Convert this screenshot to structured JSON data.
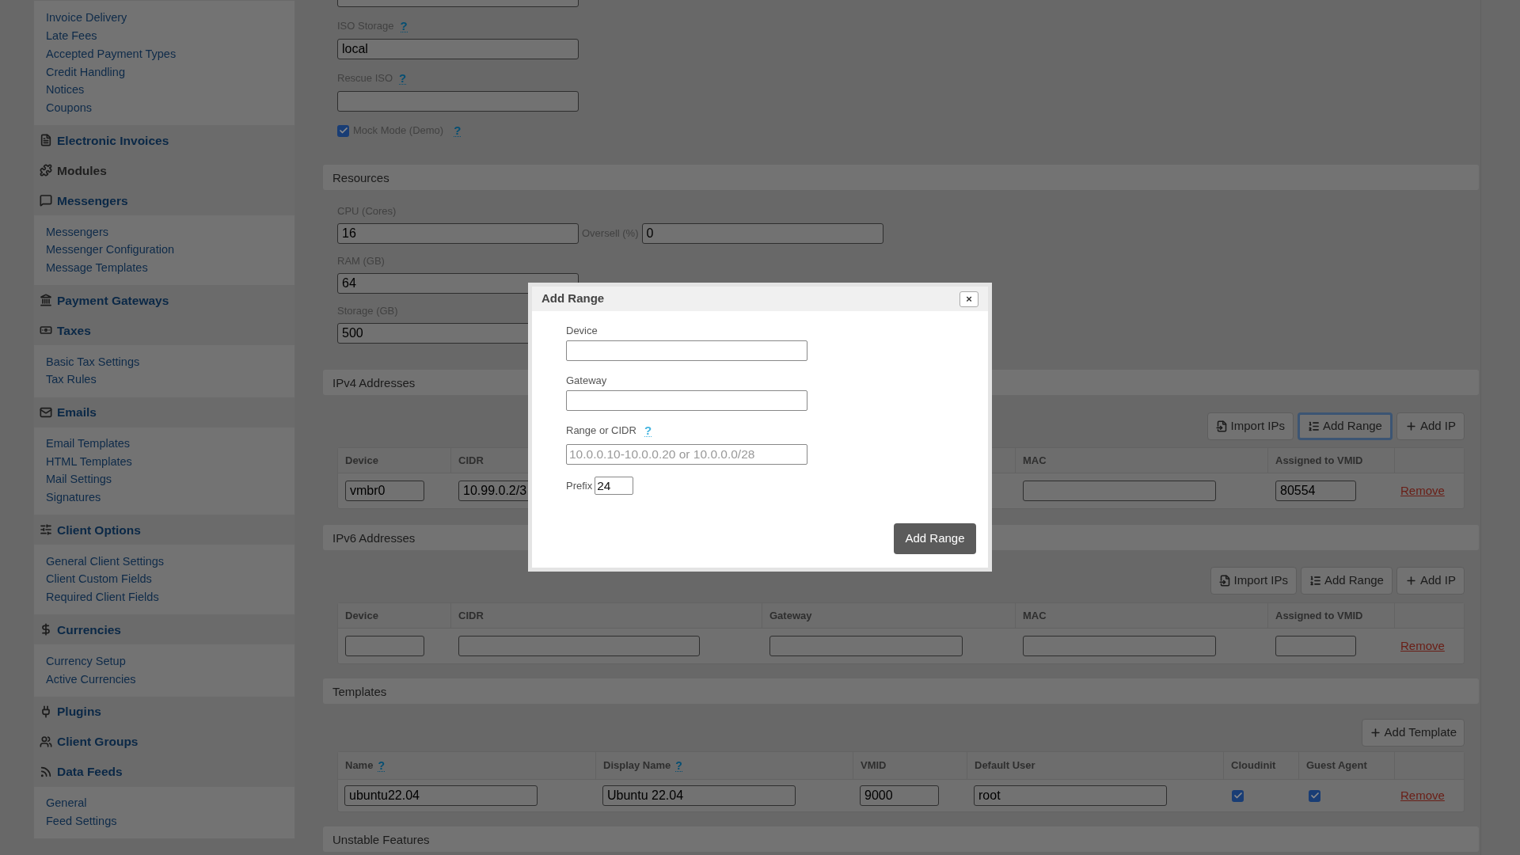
{
  "sidebar": {
    "top_items": [
      "Invoice Delivery",
      "Late Fees",
      "Accepted Payment Types",
      "Credit Handling",
      "Notices",
      "Coupons"
    ],
    "sections": [
      {
        "title": "Electronic Invoices",
        "selected": false
      },
      {
        "title": "Modules",
        "selected": true
      },
      {
        "title": "Messengers",
        "selected": false,
        "items": [
          "Messengers",
          "Messenger Configuration",
          "Message Templates"
        ]
      },
      {
        "title": "Payment Gateways",
        "selected": false
      },
      {
        "title": "Taxes",
        "selected": false,
        "items": [
          "Basic Tax Settings",
          "Tax Rules"
        ]
      },
      {
        "title": "Emails",
        "selected": false,
        "items": [
          "Email Templates",
          "HTML Templates",
          "Mail Settings",
          "Signatures"
        ]
      },
      {
        "title": "Client Options",
        "selected": false,
        "items": [
          "General Client Settings",
          "Client Custom Fields",
          "Required Client Fields"
        ]
      },
      {
        "title": "Currencies",
        "selected": false,
        "items": [
          "Currency Setup",
          "Active Currencies"
        ]
      },
      {
        "title": "Plugins",
        "selected": false
      },
      {
        "title": "Client Groups",
        "selected": false
      },
      {
        "title": "Data Feeds",
        "selected": false,
        "items": [
          "General",
          "Feed Settings"
        ]
      }
    ]
  },
  "general": {
    "iso_storage": {
      "label": "ISO Storage",
      "help": "?",
      "value": "local"
    },
    "rescue_iso": {
      "label": "Rescue ISO",
      "help": "?"
    },
    "mock_mode": {
      "label": "Mock Mode (Demo)",
      "help": "?",
      "checked": true
    }
  },
  "resources": {
    "title": "Resources",
    "rows": [
      {
        "label": "CPU (Cores)",
        "value": "16",
        "oversell_label": "Oversell (%)",
        "oversell_value": "0"
      },
      {
        "label": "RAM (GB)",
        "value": "64"
      },
      {
        "label": "Storage (GB)",
        "value": "500"
      }
    ]
  },
  "ipv4": {
    "title": "IPv4 Addresses",
    "buttons": [
      {
        "label": "Import IPs",
        "kind": "import",
        "focused": false
      },
      {
        "label": "Add Range",
        "kind": "range",
        "focused": true
      },
      {
        "label": "Add IP",
        "kind": "add",
        "focused": false
      }
    ],
    "columns": [
      {
        "kind": "device",
        "label": "Device"
      },
      {
        "kind": "cidr",
        "label": "CIDR"
      },
      {
        "kind": "mac",
        "label": "MAC"
      },
      {
        "kind": "vmid",
        "label": "Assigned to VMID"
      }
    ],
    "rows": [
      {
        "device": "vmbr0",
        "cidr": "10.99.0.2/3",
        "vmid": "80554",
        "action": "Remove"
      }
    ]
  },
  "ipv6": {
    "title": "IPv6 Addresses",
    "buttons": [
      {
        "label": "Import IPs",
        "kind": "import",
        "focused": false
      },
      {
        "label": "Add Range",
        "kind": "range",
        "focused": false
      },
      {
        "label": "Add IP",
        "kind": "add",
        "focused": false
      }
    ],
    "columns": [
      {
        "kind": "device",
        "label": "Device"
      },
      {
        "kind": "cidr",
        "label": "CIDR"
      },
      {
        "kind": "gateway",
        "label": "Gateway"
      },
      {
        "kind": "mac",
        "label": "MAC"
      },
      {
        "kind": "vmid",
        "label": "Assigned to VMID"
      }
    ],
    "rows": [
      {
        "action": "Remove"
      }
    ]
  },
  "templates": {
    "title": "Templates",
    "add_button": "Add Template",
    "columns": [
      {
        "label": "Name",
        "help": "?"
      },
      {
        "label": "Display Name",
        "help": "?"
      },
      {
        "label": "VMID"
      },
      {
        "label": "Default User"
      },
      {
        "label": "Cloudinit"
      },
      {
        "label": "Guest Agent"
      }
    ],
    "rows": [
      {
        "name": "ubuntu22.04",
        "display_name": "Ubuntu 22.04",
        "vmid": "9000",
        "default_user": "root",
        "cloudinit": true,
        "guest_agent": true,
        "action": "Remove"
      }
    ]
  },
  "unstable": {
    "title": "Unstable Features"
  },
  "modal": {
    "title": "Add Range",
    "close": "×",
    "fields": [
      {
        "label": "Device"
      },
      {
        "label": "Gateway"
      },
      {
        "label": "Range or CIDR",
        "help": "?",
        "placeholder": "10.0.0.10-10.0.0.20 or 10.0.0.0/28"
      }
    ],
    "prefix": {
      "label": "Prefix",
      "value": "24"
    },
    "submit": "Add Range"
  }
}
